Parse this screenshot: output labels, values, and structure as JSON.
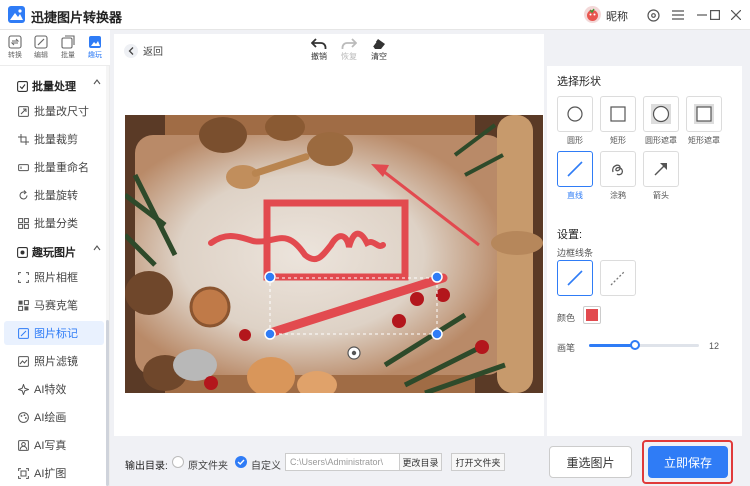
{
  "app": {
    "title": "迅捷图片转换器",
    "user_nickname": "昵称"
  },
  "icon_rail": [
    {
      "label": "转换",
      "icon": "convert-icon"
    },
    {
      "label": "编辑",
      "icon": "edit-icon"
    },
    {
      "label": "批量",
      "icon": "batch-icon"
    },
    {
      "label": "趣玩",
      "icon": "fun-icon",
      "active": true
    }
  ],
  "sidebar": {
    "section_batch": "批量处理",
    "batch_items": [
      "批量改尺寸",
      "批量裁剪",
      "批量重命名",
      "批量旋转",
      "批量分类"
    ],
    "section_fun": "趣玩图片",
    "fun_items": [
      "照片相框",
      "马赛克笔",
      "图片标记",
      "照片滤镜",
      "AI特效",
      "AI绘画",
      "AI写真",
      "AI扩图"
    ],
    "active_item": "图片标记"
  },
  "toolbar": {
    "back_label": "返回",
    "undo_label": "撤销",
    "redo_label": "恢复",
    "clear_label": "清空"
  },
  "right_panel": {
    "select_shape_title": "选择形状",
    "shapes": [
      "圆形",
      "矩形",
      "圆形遮罩",
      "矩形遮罩",
      "直线",
      "涂鸦",
      "箭头"
    ],
    "selected_shape": "直线",
    "settings_title": "设置:",
    "border_line_label": "边框线条",
    "color_label": "颜色",
    "brush_label": "画笔",
    "brush_value": "12",
    "brush_fraction": 0.42,
    "mark_color": "#e24a4f",
    "accent_color": "#2f7cf6"
  },
  "footer": {
    "output_label": "输出目录:",
    "option_original": "原文件夹",
    "option_custom": "自定义",
    "path_value": "C:\\Users\\Administrator\\",
    "change_dir": "更改目录",
    "open_folder": "打开文件夹",
    "reselect": "重选图片",
    "save": "立即保存"
  }
}
